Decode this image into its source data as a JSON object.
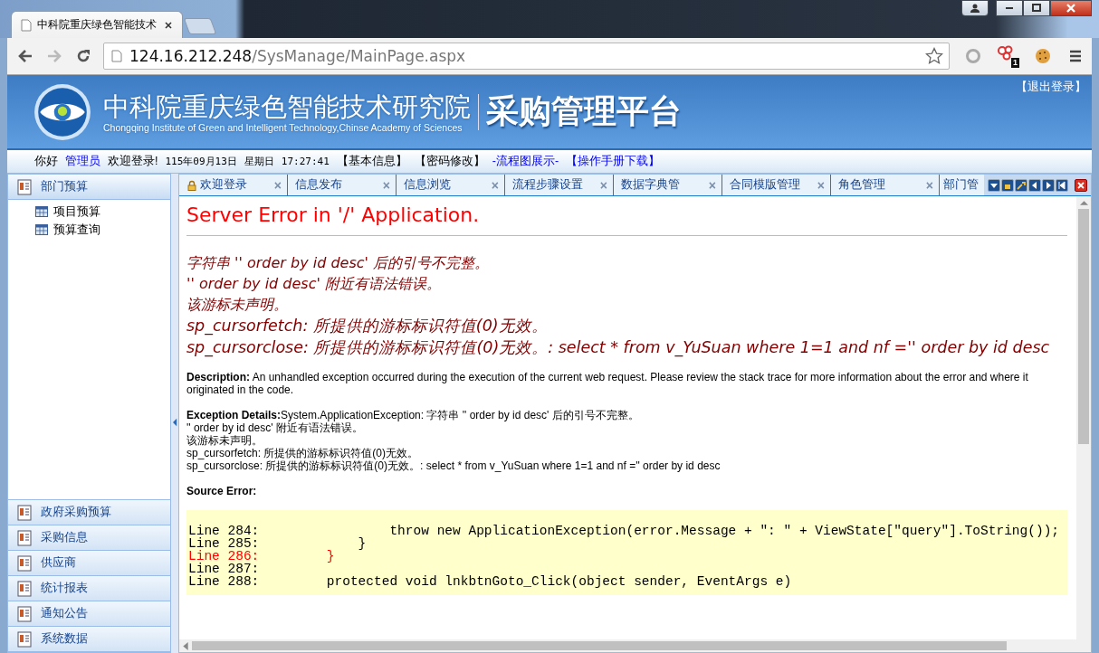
{
  "browser": {
    "tab_title": "中科院重庆绿色智能技术",
    "url_host": "124.16.212.248",
    "url_path": "/SysManage/MainPage.aspx",
    "extension_badge": "1"
  },
  "header": {
    "org_name": "中科院重庆绿色智能技术研究院",
    "org_name_en": "Chongqing Institute of Green and Intelligent Technology,Chinse Academy of Sciences",
    "platform_title": "采购管理平台",
    "logout": "【退出登录】"
  },
  "info_bar": [
    {
      "kind": "plain",
      "text": "你好"
    },
    {
      "kind": "link",
      "text": "管理员"
    },
    {
      "kind": "plain",
      "text": "欢迎登录!"
    },
    {
      "kind": "mono",
      "text": "115年09月13日"
    },
    {
      "kind": "mono",
      "text": "星期日"
    },
    {
      "kind": "mono",
      "text": "17:27:41"
    },
    {
      "kind": "plain",
      "text": "【基本信息】"
    },
    {
      "kind": "plain",
      "text": "【密码修改】"
    },
    {
      "kind": "link",
      "text": "-流程图展示-"
    },
    {
      "kind": "link",
      "text": "【操作手册下载】"
    }
  ],
  "sidebar": {
    "sections": [
      {
        "label": "部门预算",
        "expanded": true,
        "children": [
          {
            "label": "项目预算"
          },
          {
            "label": "预算查询"
          }
        ]
      },
      {
        "label": "政府采购预算",
        "expanded": false
      },
      {
        "label": "采购信息",
        "expanded": false
      },
      {
        "label": "供应商",
        "expanded": false
      },
      {
        "label": "统计报表",
        "expanded": false
      },
      {
        "label": "通知公告",
        "expanded": false
      },
      {
        "label": "系统数据",
        "expanded": false
      }
    ]
  },
  "tabs": [
    {
      "label": "欢迎登录",
      "selected": false,
      "locked": true
    },
    {
      "label": "信息发布",
      "selected": false,
      "locked": false
    },
    {
      "label": "信息浏览",
      "selected": false,
      "locked": false
    },
    {
      "label": "流程步骤设置",
      "selected": false,
      "locked": false
    },
    {
      "label": "数据字典管",
      "selected": false,
      "locked": false
    },
    {
      "label": "合同模版管理",
      "selected": false,
      "locked": false
    },
    {
      "label": "角色管理",
      "selected": false,
      "locked": false
    },
    {
      "label": "部门管",
      "selected": false,
      "locked": false
    }
  ],
  "tab_close": "×",
  "error": {
    "title": "Server Error in '/' Application.",
    "messages": [
      "字符串 '' order by  id desc' 后的引号不完整。",
      "'' order by  id desc' 附近有语法错误。",
      "该游标未声明。",
      "sp_cursorfetch: 所提供的游标标识符值(0)无效。",
      "sp_cursorclose: 所提供的游标标识符值(0)无效。: select * from v_YuSuan where 1=1 and nf ='' order by  id desc"
    ],
    "description_label": "Description:",
    "description": "An unhandled exception occurred during the execution of the current web request. Please review the stack trace for more information about the error and where it originated in the code.",
    "exception_label": "Exception Details:",
    "exception_lines": [
      "System.ApplicationException: 字符串 '' order by  id desc' 后的引号不完整。",
      "'' order by  id desc' 附近有语法错误。",
      "该游标未声明。",
      "sp_cursorfetch: 所提供的游标标识符值(0)无效。",
      "sp_cursorclose: 所提供的游标标识符值(0)无效。: select * from v_YuSuan where 1=1 and nf ='' order by  id desc"
    ],
    "source_label": "Source Error:",
    "code_lines": [
      {
        "number": "Line 284:",
        "code": "            throw new ApplicationException(error.Message + \": \" + ViewState[\"query\"].ToString());",
        "highlight": false
      },
      {
        "number": "Line 285:",
        "code": "        }",
        "highlight": false
      },
      {
        "number": "Line 286:",
        "code": "    }",
        "highlight": true
      },
      {
        "number": "Line 287:",
        "highlight": false
      },
      {
        "number": "Line 288:",
        "code": "    protected void lnkbtnGoto_Click(object sender, EventArgs e)",
        "highlight": false
      }
    ]
  }
}
